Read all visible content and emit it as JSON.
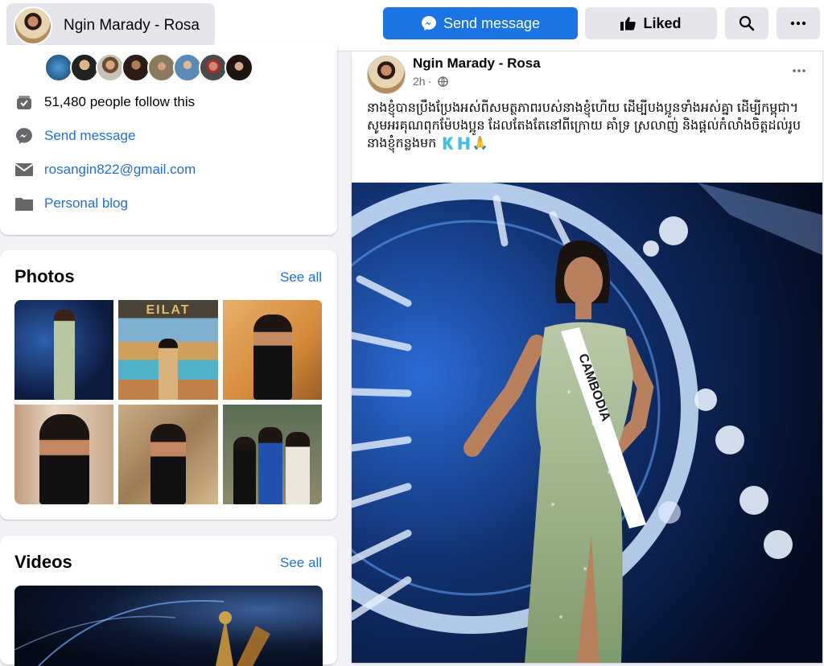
{
  "header": {
    "page_name": "Ngin Marady - Rosa",
    "send_message_label": "Send message",
    "liked_label": "Liked",
    "search_icon": "search-icon",
    "more_icon": "more-icon"
  },
  "intro": {
    "follower_text": "51,480 people follow this",
    "send_message_link": "Send message",
    "email": "rosangin822@gmail.com",
    "blog_link": "Personal blog"
  },
  "photos": {
    "title": "Photos",
    "see_all": "See all",
    "sign_text": "EILAT"
  },
  "videos": {
    "title": "Videos",
    "see_all": "See all"
  },
  "post": {
    "author": "Ngin Marady - Rosa",
    "time": "2h",
    "text_line1": "នាងខ្ញុំបានប្រឹងប្រែងអស់ពីសមត្ថភាពរបស់នាងខ្ញុំហើយ ដើម្បីបងប្អូនទាំងអស់គ្នា ដើម្បីកម្ពុជា។",
    "text_line2": "សូមអរគុណពុកម៉ែបងប្អូន ដែលតែងតែនៅពីក្រោយ គាំទ្រ ស្រលាញ់ និងផ្តល់កំលាំងចិត្តដល់រូបនាងខ្ញុំកន្លងមក 🇰🇭🙏",
    "sash_text": "CAMBODIA"
  },
  "colors": {
    "accent": "#1b74e4",
    "link": "#216fdb",
    "secondary_bg": "#e4e6eb",
    "page_bg": "#f0f2f5"
  }
}
